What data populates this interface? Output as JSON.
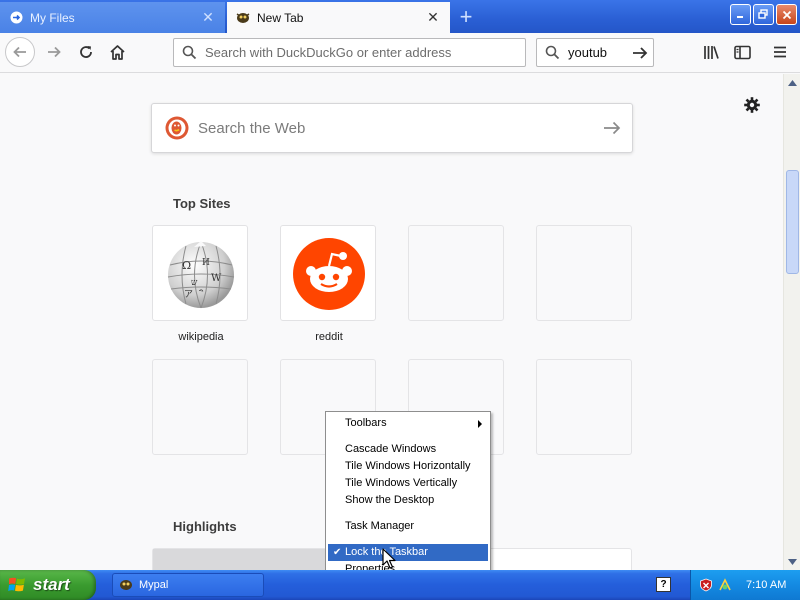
{
  "browser": {
    "tabs": [
      {
        "title": "My Files",
        "active": false
      },
      {
        "title": "New Tab",
        "active": true
      }
    ],
    "urlbar": {
      "placeholder": "Search with DuckDuckGo or enter address"
    },
    "searchbar": {
      "value": "youtub"
    }
  },
  "newtab": {
    "search": {
      "placeholder": "Search the Web"
    },
    "top_sites_title": "Top Sites",
    "top_sites": [
      {
        "label": "wikipedia",
        "icon": "wikipedia-globe"
      },
      {
        "label": "reddit",
        "icon": "reddit-alien"
      }
    ],
    "highlights_title": "Highlights"
  },
  "context_menu": {
    "items": [
      {
        "label": "Toolbars",
        "submenu": true
      },
      {
        "label": "Cascade Windows"
      },
      {
        "label": "Tile Windows Horizontally"
      },
      {
        "label": "Tile Windows Vertically"
      },
      {
        "label": "Show the Desktop"
      },
      {
        "label": "Task Manager"
      },
      {
        "label": "Lock the Taskbar",
        "checked": true,
        "selected": true
      },
      {
        "label": "Properties"
      }
    ]
  },
  "taskbar": {
    "start_label": "start",
    "task_button": "Mypal",
    "help_label": "?",
    "clock": "7:10 AM"
  },
  "colors": {
    "accent": "#316ac5",
    "reddit": "#ff4500",
    "ddg": "#de5833",
    "taskbar": "#245edb",
    "start": "#3a9b2f"
  }
}
